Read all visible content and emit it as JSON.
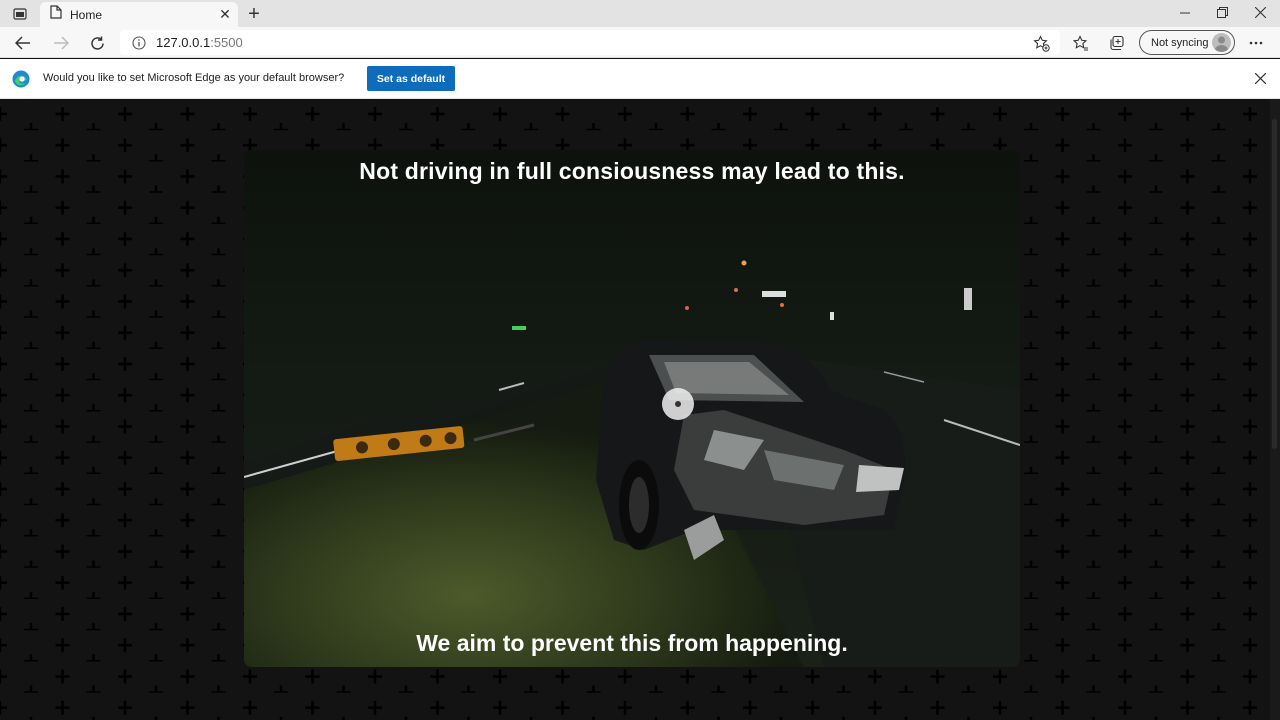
{
  "browser": {
    "tab": {
      "title": "Home"
    },
    "address_bar": {
      "host": "127.0.0.1",
      "port": ":5500"
    },
    "profile": {
      "label": "Not syncing"
    },
    "infobar": {
      "message": "Would you like to set Microsoft Edge as your default browser?",
      "button_label": "Set as default"
    }
  },
  "page": {
    "heading": "Not driving in full consiousness may lead to this.",
    "caption": "We aim to prevent this from happening.",
    "colors": {
      "background": "#131313",
      "plus_pattern": "#000000",
      "text": "#ffffff"
    }
  }
}
